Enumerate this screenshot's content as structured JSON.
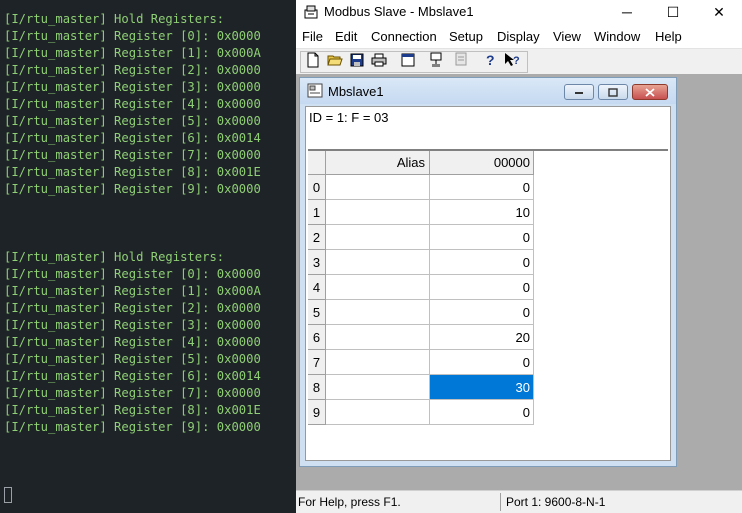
{
  "terminal": {
    "lines": [
      "[I/rtu_master] Hold Registers:",
      "[I/rtu_master] Register [0]: 0x0000",
      "[I/rtu_master] Register [1]: 0x000A",
      "[I/rtu_master] Register [2]: 0x0000",
      "[I/rtu_master] Register [3]: 0x0000",
      "[I/rtu_master] Register [4]: 0x0000",
      "[I/rtu_master] Register [5]: 0x0000",
      "[I/rtu_master] Register [6]: 0x0014",
      "[I/rtu_master] Register [7]: 0x0000",
      "[I/rtu_master] Register [8]: 0x001E",
      "[I/rtu_master] Register [9]: 0x0000",
      "",
      "",
      "",
      "[I/rtu_master] Hold Registers:",
      "[I/rtu_master] Register [0]: 0x0000",
      "[I/rtu_master] Register [1]: 0x000A",
      "[I/rtu_master] Register [2]: 0x0000",
      "[I/rtu_master] Register [3]: 0x0000",
      "[I/rtu_master] Register [4]: 0x0000",
      "[I/rtu_master] Register [5]: 0x0000",
      "[I/rtu_master] Register [6]: 0x0014",
      "[I/rtu_master] Register [7]: 0x0000",
      "[I/rtu_master] Register [8]: 0x001E",
      "[I/rtu_master] Register [9]: 0x0000"
    ],
    "text_color": "#8fcf75",
    "background": "#1e2328"
  },
  "window": {
    "title": "Modbus Slave - Mbslave1",
    "minimize_glyph": "─",
    "maximize_glyph": "☐",
    "close_glyph": "✕"
  },
  "menu": [
    "File",
    "Edit",
    "Connection",
    "Setup",
    "Display",
    "View",
    "Window",
    "Help"
  ],
  "toolbar": {
    "icons": [
      "new-icon",
      "open-icon",
      "save-icon",
      "print-icon",
      "window-icon",
      "connect-icon",
      "disconnect-icon",
      "help-icon",
      "context-help-icon"
    ]
  },
  "child_window": {
    "title": "Mbslave1",
    "id_line": "ID = 1: F = 03"
  },
  "table": {
    "alias_header": "Alias",
    "value_header": "00000",
    "row_labels": [
      "0",
      "1",
      "2",
      "3",
      "4",
      "5",
      "6",
      "7",
      "8",
      "9"
    ],
    "values": [
      "0",
      "10",
      "0",
      "0",
      "0",
      "0",
      "20",
      "0",
      "30",
      "0"
    ],
    "selected_row": 8,
    "selected_color": "#0078d7"
  },
  "status": {
    "left": "For Help, press F1.",
    "right": "Port 1: 9600-8-N-1"
  }
}
